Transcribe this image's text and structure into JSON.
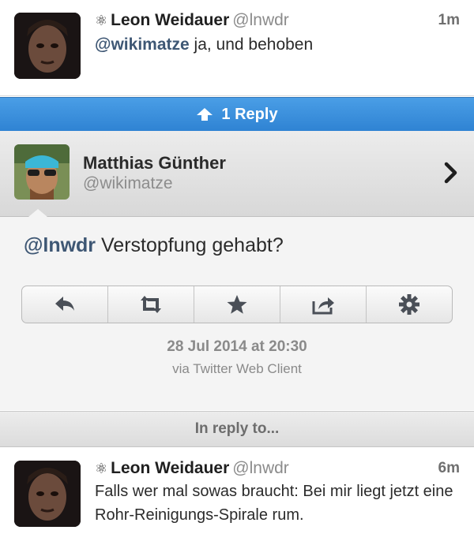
{
  "top_tweet": {
    "atom_glyph": "⚛",
    "name": "Leon Weidauer",
    "handle": "@lnwdr",
    "time": "1m",
    "mention": "@wikimatze",
    "text": " ja, und behoben"
  },
  "reply_bar": {
    "icon": "up-arrow-icon",
    "label": "1 Reply"
  },
  "user": {
    "name": "Matthias Günther",
    "handle": "@wikimatze"
  },
  "detail": {
    "mention": "@lnwdr",
    "text": " Verstopfung gehabt?",
    "actions": [
      {
        "icon": "reply-icon"
      },
      {
        "icon": "retweet-icon"
      },
      {
        "icon": "star-icon"
      },
      {
        "icon": "share-icon"
      },
      {
        "icon": "gear-icon"
      }
    ],
    "date": "28 Jul 2014 at 20:30",
    "via": "via Twitter Web Client"
  },
  "in_reply_to_label": "In reply to...",
  "bottom_tweet": {
    "atom_glyph": "⚛",
    "name": "Leon Weidauer",
    "handle": "@lnwdr",
    "time": "6m",
    "text": "Falls wer mal sowas braucht: Bei mir liegt jetzt eine Rohr-Reinigungs-Spirale rum."
  },
  "colors": {
    "reply_bar": "#3a8fdc",
    "mention": "#3e5774"
  }
}
